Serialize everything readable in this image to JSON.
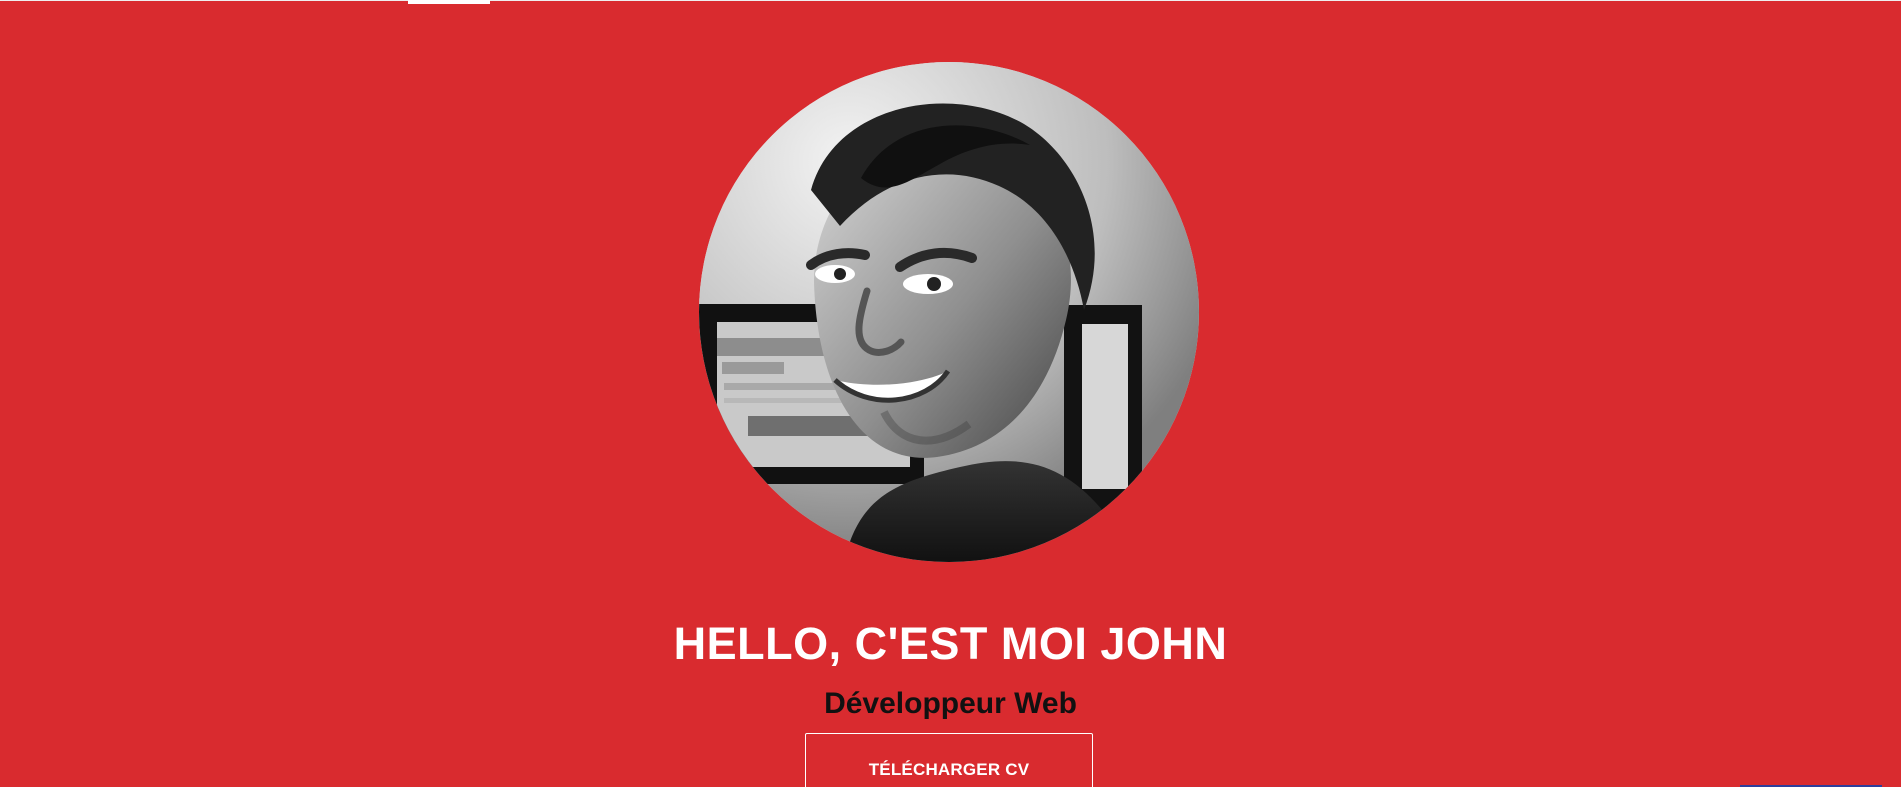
{
  "hero": {
    "title": "HELLO, C'EST MOI JOHN",
    "subtitle": "Développeur Web",
    "button_label": "TÉLÉCHARGER CV"
  },
  "colors": {
    "background": "#d92b2f",
    "title": "#ffffff",
    "subtitle": "#111111",
    "button_border": "#ffffff"
  },
  "icons": {
    "avatar": "portrait-photo"
  }
}
